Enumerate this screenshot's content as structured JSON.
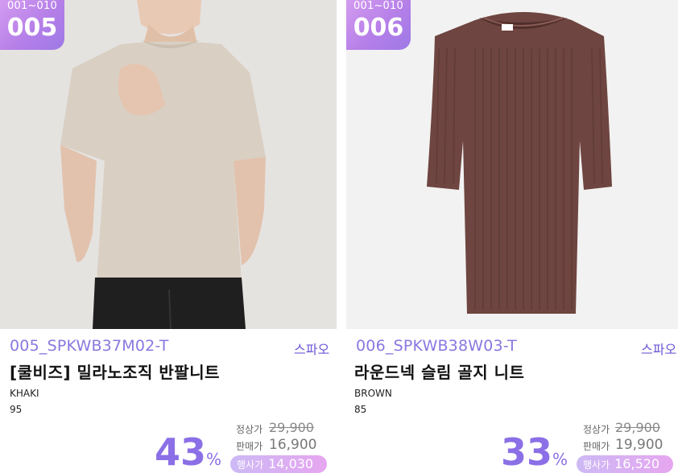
{
  "products": [
    {
      "rank_range": "001~010",
      "rank": "005",
      "code": "005_SPKWB37M02-T",
      "brand": "스파오",
      "title": "[쿨비즈] 밀라노조직 반팔니트",
      "color": "KHAKI",
      "size": "95",
      "discount": "43",
      "percent_sign": "%",
      "regular_label": "정상가",
      "regular_price": "29,900",
      "sale_label": "판매가",
      "sale_price": "16,900",
      "event_label": "행사가",
      "event_price": "14,030",
      "image_icon": "model-wearing-beige-knit-icon",
      "accent": "#d9cfc3"
    },
    {
      "rank_range": "001~010",
      "rank": "006",
      "code": "006_SPKWB38W03-T",
      "brand": "스파오",
      "title": "라운드넥 슬림 골지 니트",
      "color": "BROWN",
      "size": "85",
      "discount": "33",
      "percent_sign": "%",
      "regular_label": "정상가",
      "regular_price": "29,900",
      "sale_label": "판매가",
      "sale_price": "19,900",
      "event_label": "행사가",
      "event_price": "16,520",
      "image_icon": "brown-ribbed-knit-icon",
      "accent": "#6e4540"
    }
  ]
}
